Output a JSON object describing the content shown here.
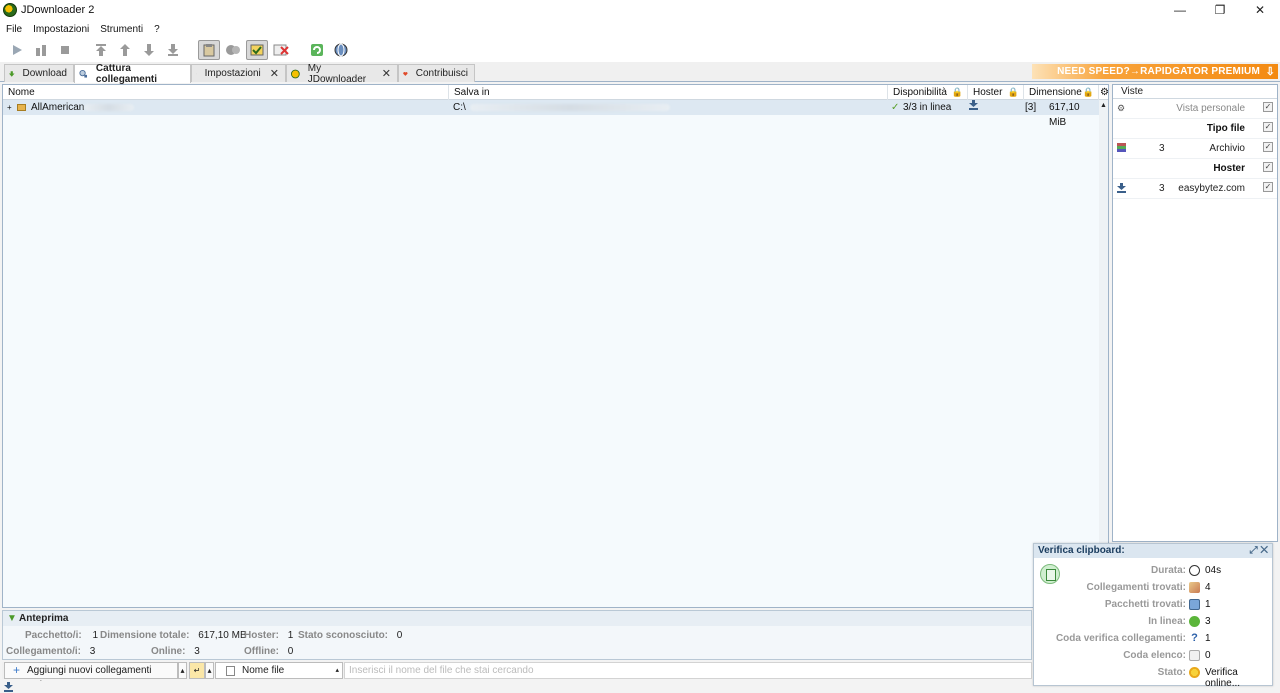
{
  "window": {
    "title": "JDownloader 2",
    "minimize": "—",
    "restore": "❐",
    "close": "✕"
  },
  "menu": [
    "File",
    "Impostazioni",
    "Strumenti",
    "?"
  ],
  "tabs": [
    {
      "label": "Download"
    },
    {
      "label": "Cattura collegamenti"
    },
    {
      "label": "Impostazioni",
      "close": "✕"
    },
    {
      "label": "My JDownloader",
      "close": "✕"
    },
    {
      "label": "Contribuisci"
    }
  ],
  "promo": {
    "text": "NEED SPEED?→RAPIDGATOR PREMIUM"
  },
  "table": {
    "columns": {
      "name": "Nome",
      "save_in": "Salva in",
      "availability": "Disponibilità",
      "hoster": "Hoster",
      "size": "Dimensione"
    },
    "rows": [
      {
        "expand": "+",
        "name": "AllAmerican",
        "save_in": "C:\\",
        "availability": "3/3 in linea",
        "hoster_icon": "download-icon",
        "count": "[3]",
        "size": "617,10 MiB"
      }
    ]
  },
  "views": {
    "header": "Viste",
    "personal": "Vista personale",
    "filetype_header": "Tipo file",
    "filetype_item": {
      "count": "3",
      "label": "Archivio"
    },
    "hoster_header": "Hoster",
    "hoster_item": {
      "count": "3",
      "label": "easybytez.com"
    }
  },
  "preview": {
    "title": "Anteprima",
    "packages_label": "Pacchetto/i:",
    "packages": "1",
    "total_size_label": "Dimensione totale:",
    "total_size": "617,10 MB",
    "hoster_label": "Hoster:",
    "hoster": "1",
    "unknown_label": "Stato sconosciuto:",
    "unknown": "0",
    "links_label": "Collegamento/i:",
    "links": "3",
    "online_label": "Online:",
    "online": "3",
    "offline_label": "Offline:",
    "offline": "0"
  },
  "bottom": {
    "add_links": "Aggiungi nuovi collegamenti web...",
    "filter_select": "Nome file",
    "search_placeholder": "Inserisci il nome del file che stai cercando"
  },
  "clipboard": {
    "title": "Verifica clipboard:",
    "rows": [
      {
        "label": "Durata:",
        "value": "04s"
      },
      {
        "label": "Collegamenti trovati:",
        "value": "4"
      },
      {
        "label": "Pacchetti trovati:",
        "value": "1"
      },
      {
        "label": "In linea:",
        "value": "3"
      },
      {
        "label": "Coda verifica collegamenti:",
        "value": "1"
      },
      {
        "label": "Coda elenco:",
        "value": "0"
      },
      {
        "label": "Stato:",
        "value": "Verifica online..."
      }
    ]
  },
  "colors": {
    "accent": "#f38a12",
    "selection": "#dde8f2",
    "border": "#9fb3c8"
  }
}
